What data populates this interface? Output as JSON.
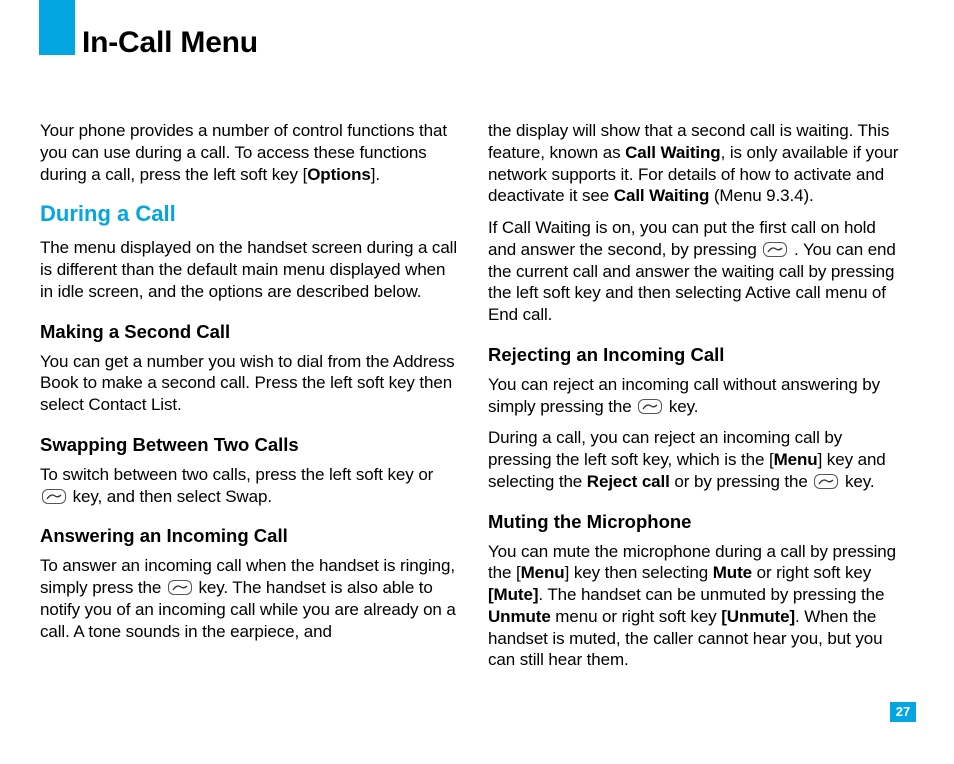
{
  "page_title": "In-Call Menu",
  "page_number": "27",
  "left": {
    "intro_a": "Your phone provides a number of control functions that you can use during a call. To access these functions during a call, press the left soft key [",
    "intro_bold": "Options",
    "intro_b": "].",
    "during_heading": "During a Call",
    "during_p": "The menu displayed on the handset screen during a call is different than the default main menu displayed when in idle screen, and the options are described below.",
    "second_h": "Making a Second Call",
    "second_p": "You can get a number you wish to dial from the Address Book to make a second call. Press the left soft key then select Contact List.",
    "swap_h": "Swapping Between Two Calls",
    "swap_a": "To switch between two calls, press the left soft key or ",
    "swap_b": " key, and then select Swap.",
    "ans_h": "Answering an Incoming Call",
    "ans_a": "To answer an incoming call when the handset is ringing, simply press the ",
    "ans_b": " key. The handset is also able to notify you of an incoming call while you are already on a call. A tone sounds in the earpiece, and"
  },
  "right": {
    "cw_a": "the display will show that a second call is waiting. This feature, known as ",
    "cw_bold1": "Call Waiting",
    "cw_b": ", is only available if your network supports it. For details of how to activate and deactivate it see ",
    "cw_bold2": "Call Waiting",
    "cw_c": " (Menu 9.3.4).",
    "cw2_a": "If Call Waiting is on, you can put the first call on hold and answer the second, by pressing ",
    "cw2_b": " . You can end the current call and answer the waiting call by pressing the left soft key and then selecting Active call menu of End call.",
    "rej_h": "Rejecting an Incoming Call",
    "rej_a": "You can reject an incoming call without answering by simply pressing the ",
    "rej_b": " key.",
    "rej2_a": "During a call, you can reject an incoming call by pressing the left soft key, which is the [",
    "rej2_bold1": "Menu",
    "rej2_b": "] key and selecting the ",
    "rej2_bold2": "Reject call",
    "rej2_c": " or by pressing the ",
    "rej2_d": " key.",
    "mute_h": "Muting the Microphone",
    "mute_a": "You can mute the microphone during a call by pressing the [",
    "mute_b1": "Menu",
    "mute_b": "] key then selecting ",
    "mute_b2": "Mute",
    "mute_c": " or right soft key ",
    "mute_b3": "[Mute]",
    "mute_d": ". The handset can be unmuted by pressing the ",
    "mute_b4": "Unmute",
    "mute_e": " menu or right soft key ",
    "mute_b5": "[Unmute]",
    "mute_f": ". When the handset is muted, the caller cannot hear you, but you can still hear them."
  }
}
